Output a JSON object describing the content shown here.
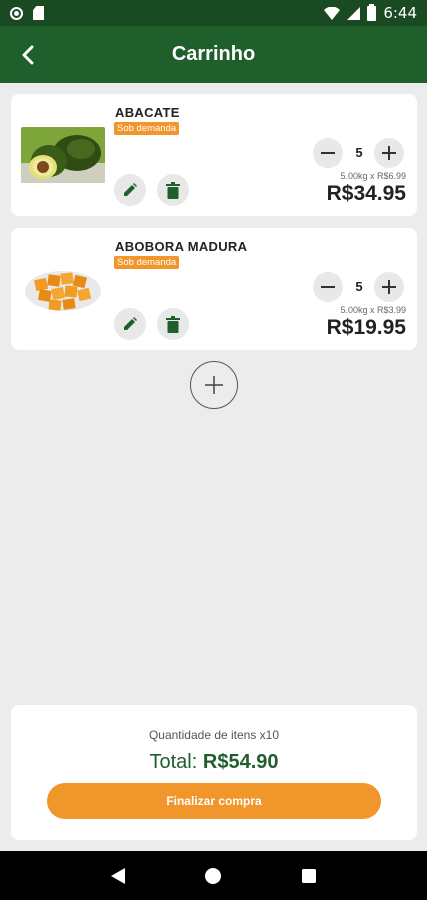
{
  "status_bar": {
    "time": "6:44"
  },
  "app_bar": {
    "title": "Carrinho"
  },
  "cart_items": [
    {
      "name": "ABACATE",
      "badge": "Sob demanda",
      "quantity": "5",
      "unit_detail": "5.00kg x R$6.99",
      "price": "R$34.95",
      "image_icon": "avocado-image"
    },
    {
      "name": "ABOBORA MADURA",
      "badge": "Sob demanda",
      "quantity": "5",
      "unit_detail": "5.00kg x R$3.99",
      "price": "R$19.95",
      "image_icon": "pumpkin-image"
    }
  ],
  "summary": {
    "items_count": "Quantidade de itens x10",
    "total_label": "Total:",
    "total_value": "R$54.90",
    "checkout_label": "Finalizar compra"
  },
  "colors": {
    "primary": "#1f5f2b",
    "status_bar": "#1a4a22",
    "accent": "#f0962a",
    "background": "#ececec"
  }
}
